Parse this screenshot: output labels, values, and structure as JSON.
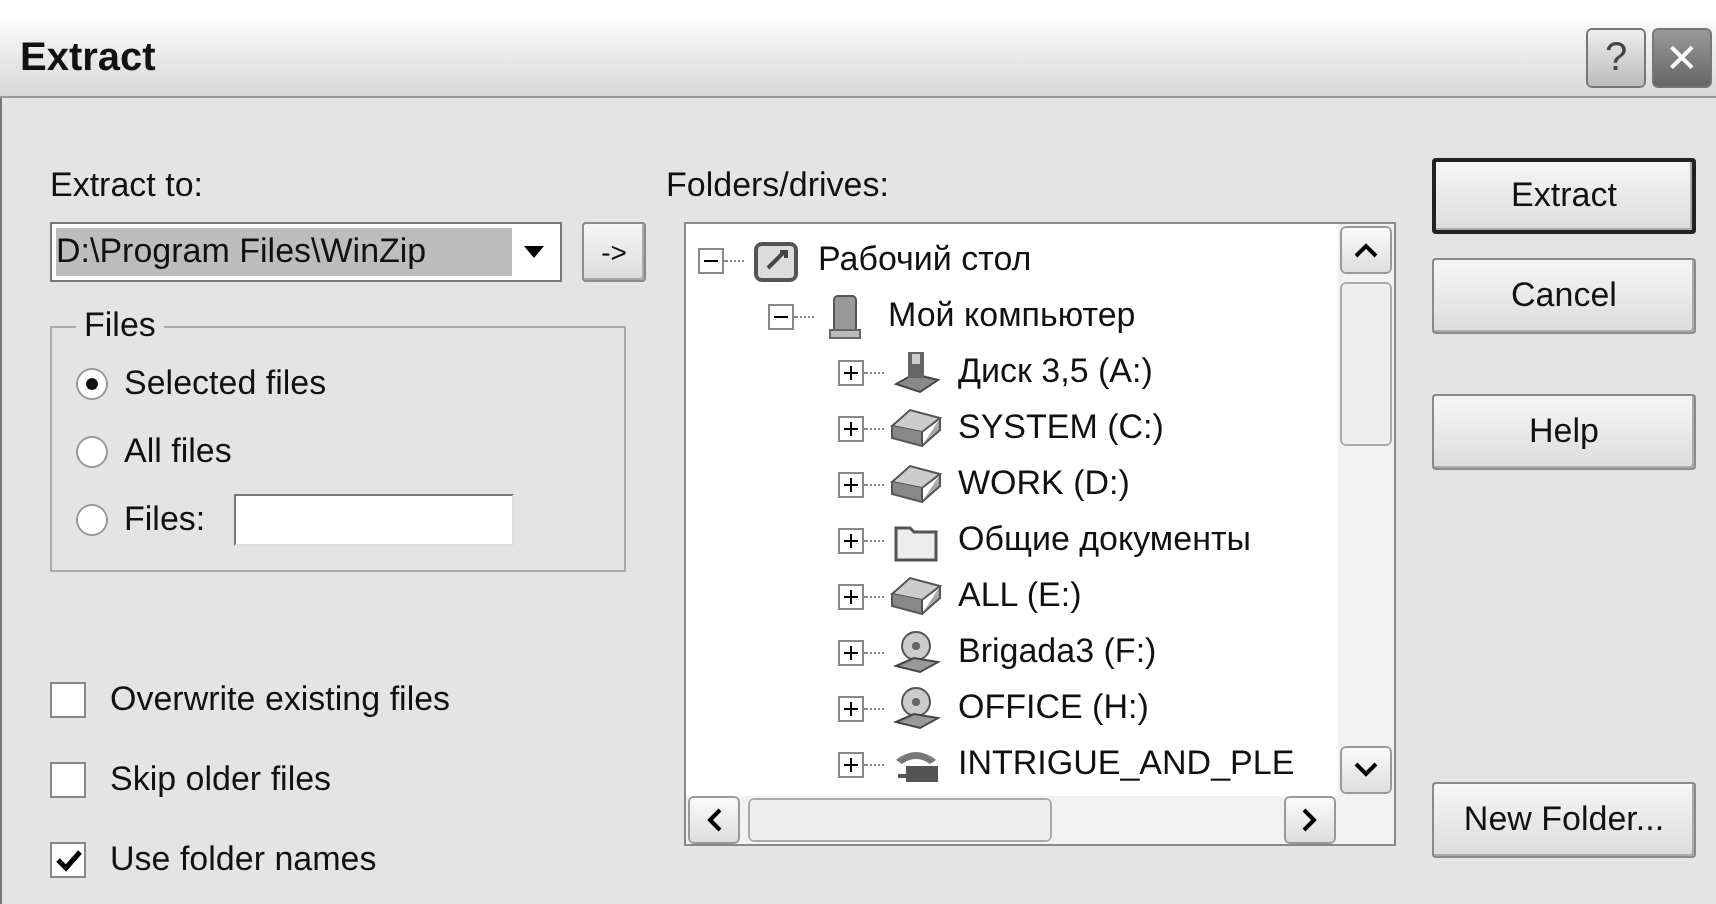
{
  "window": {
    "title": "Extract",
    "help_button": "?",
    "close_button": "✕"
  },
  "extract_to": {
    "label": "Extract to:",
    "value": "D:\\Program Files\\WinZip",
    "go_button": "->"
  },
  "files_group": {
    "title": "Files",
    "options": [
      {
        "label": "Selected files",
        "selected": true
      },
      {
        "label": "All files",
        "selected": false
      },
      {
        "label": "Files:",
        "selected": false,
        "kind": "field"
      }
    ]
  },
  "options": [
    {
      "label": "Overwrite existing files",
      "checked": false
    },
    {
      "label": "Skip older files",
      "checked": false
    },
    {
      "label": "Use folder names",
      "checked": true
    }
  ],
  "folders": {
    "label": "Folders/drives:",
    "tree": [
      {
        "label": "Рабочий стол",
        "kind": "desktop",
        "expanded": true,
        "children": [
          {
            "label": "Мой компьютер",
            "kind": "computer",
            "expanded": true,
            "children": [
              {
                "label": "Диск 3,5 (A:)",
                "kind": "floppy",
                "expanded": false
              },
              {
                "label": "SYSTEM (C:)",
                "kind": "drive",
                "expanded": false
              },
              {
                "label": "WORK (D:)",
                "kind": "drive",
                "expanded": false
              },
              {
                "label": "Общие документы",
                "kind": "folder",
                "expanded": false
              },
              {
                "label": "ALL (E:)",
                "kind": "drive",
                "expanded": false
              },
              {
                "label": "Brigada3 (F:)",
                "kind": "cdrom",
                "expanded": false
              },
              {
                "label": "OFFICE (H:)",
                "kind": "cdrom",
                "expanded": false
              },
              {
                "label": "INTRIGUE_AND_PLE",
                "kind": "network",
                "expanded": false
              }
            ]
          }
        ]
      }
    ]
  },
  "buttons": [
    {
      "label": "Extract",
      "default": true
    },
    {
      "label": "Cancel",
      "default": false
    },
    {
      "label": "Help",
      "default": false
    },
    {
      "label": "New Folder...",
      "default": false
    }
  ]
}
